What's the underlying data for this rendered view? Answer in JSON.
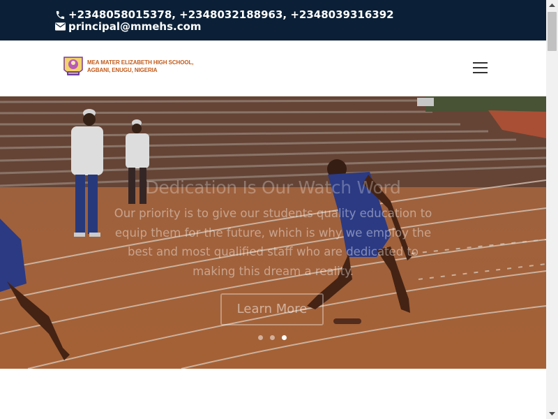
{
  "topbar": {
    "phones": "+2348058015378, +2348032188963, +2348039316392",
    "email": "principal@mmehs.com",
    "icons": [
      "phone-icon",
      "envelope-icon"
    ]
  },
  "header": {
    "school_name_line1": "MEA MATER ELIZABETH HIGH SCHOOL,",
    "school_name_line2": "AGBANI, ENUGU, NIGERIA",
    "menu_icon": "hamburger-menu-icon"
  },
  "hero": {
    "title": "Dedication Is Our Watch Word",
    "text": "Our priority is to give our students quality education to equip them for the future, which is why we employ the best and most qualified staff who are dedicated to making this dream a reality.",
    "button_label": "Learn More",
    "slides_total": 3,
    "active_slide": 3
  },
  "colors": {
    "topbar_bg": "#0b2036",
    "logo_text": "#c25a1a",
    "track": "#b46a3c"
  }
}
